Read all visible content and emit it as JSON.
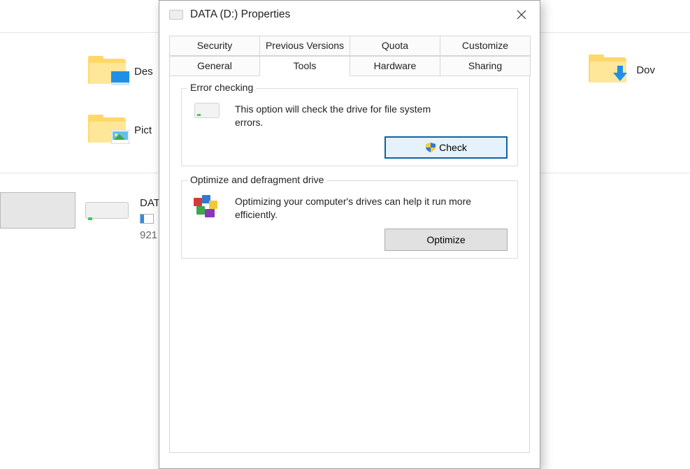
{
  "explorer": {
    "items": [
      {
        "label": "Des"
      },
      {
        "label": "Pict"
      }
    ],
    "downloads_label": "Dov",
    "drive": {
      "name": "DAT",
      "sub": "921"
    }
  },
  "dialog": {
    "title": "DATA (D:) Properties",
    "tabs_row1": [
      "Security",
      "Previous Versions",
      "Quota",
      "Customize"
    ],
    "tabs_row2": [
      "General",
      "Tools",
      "Hardware",
      "Sharing"
    ],
    "active_tab": "Tools",
    "error_check": {
      "title": "Error checking",
      "desc": "This option will check the drive for file system errors.",
      "button": "Check"
    },
    "optimize": {
      "title": "Optimize and defragment drive",
      "desc": "Optimizing your computer's drives can help it run more efficiently.",
      "button": "Optimize"
    }
  }
}
